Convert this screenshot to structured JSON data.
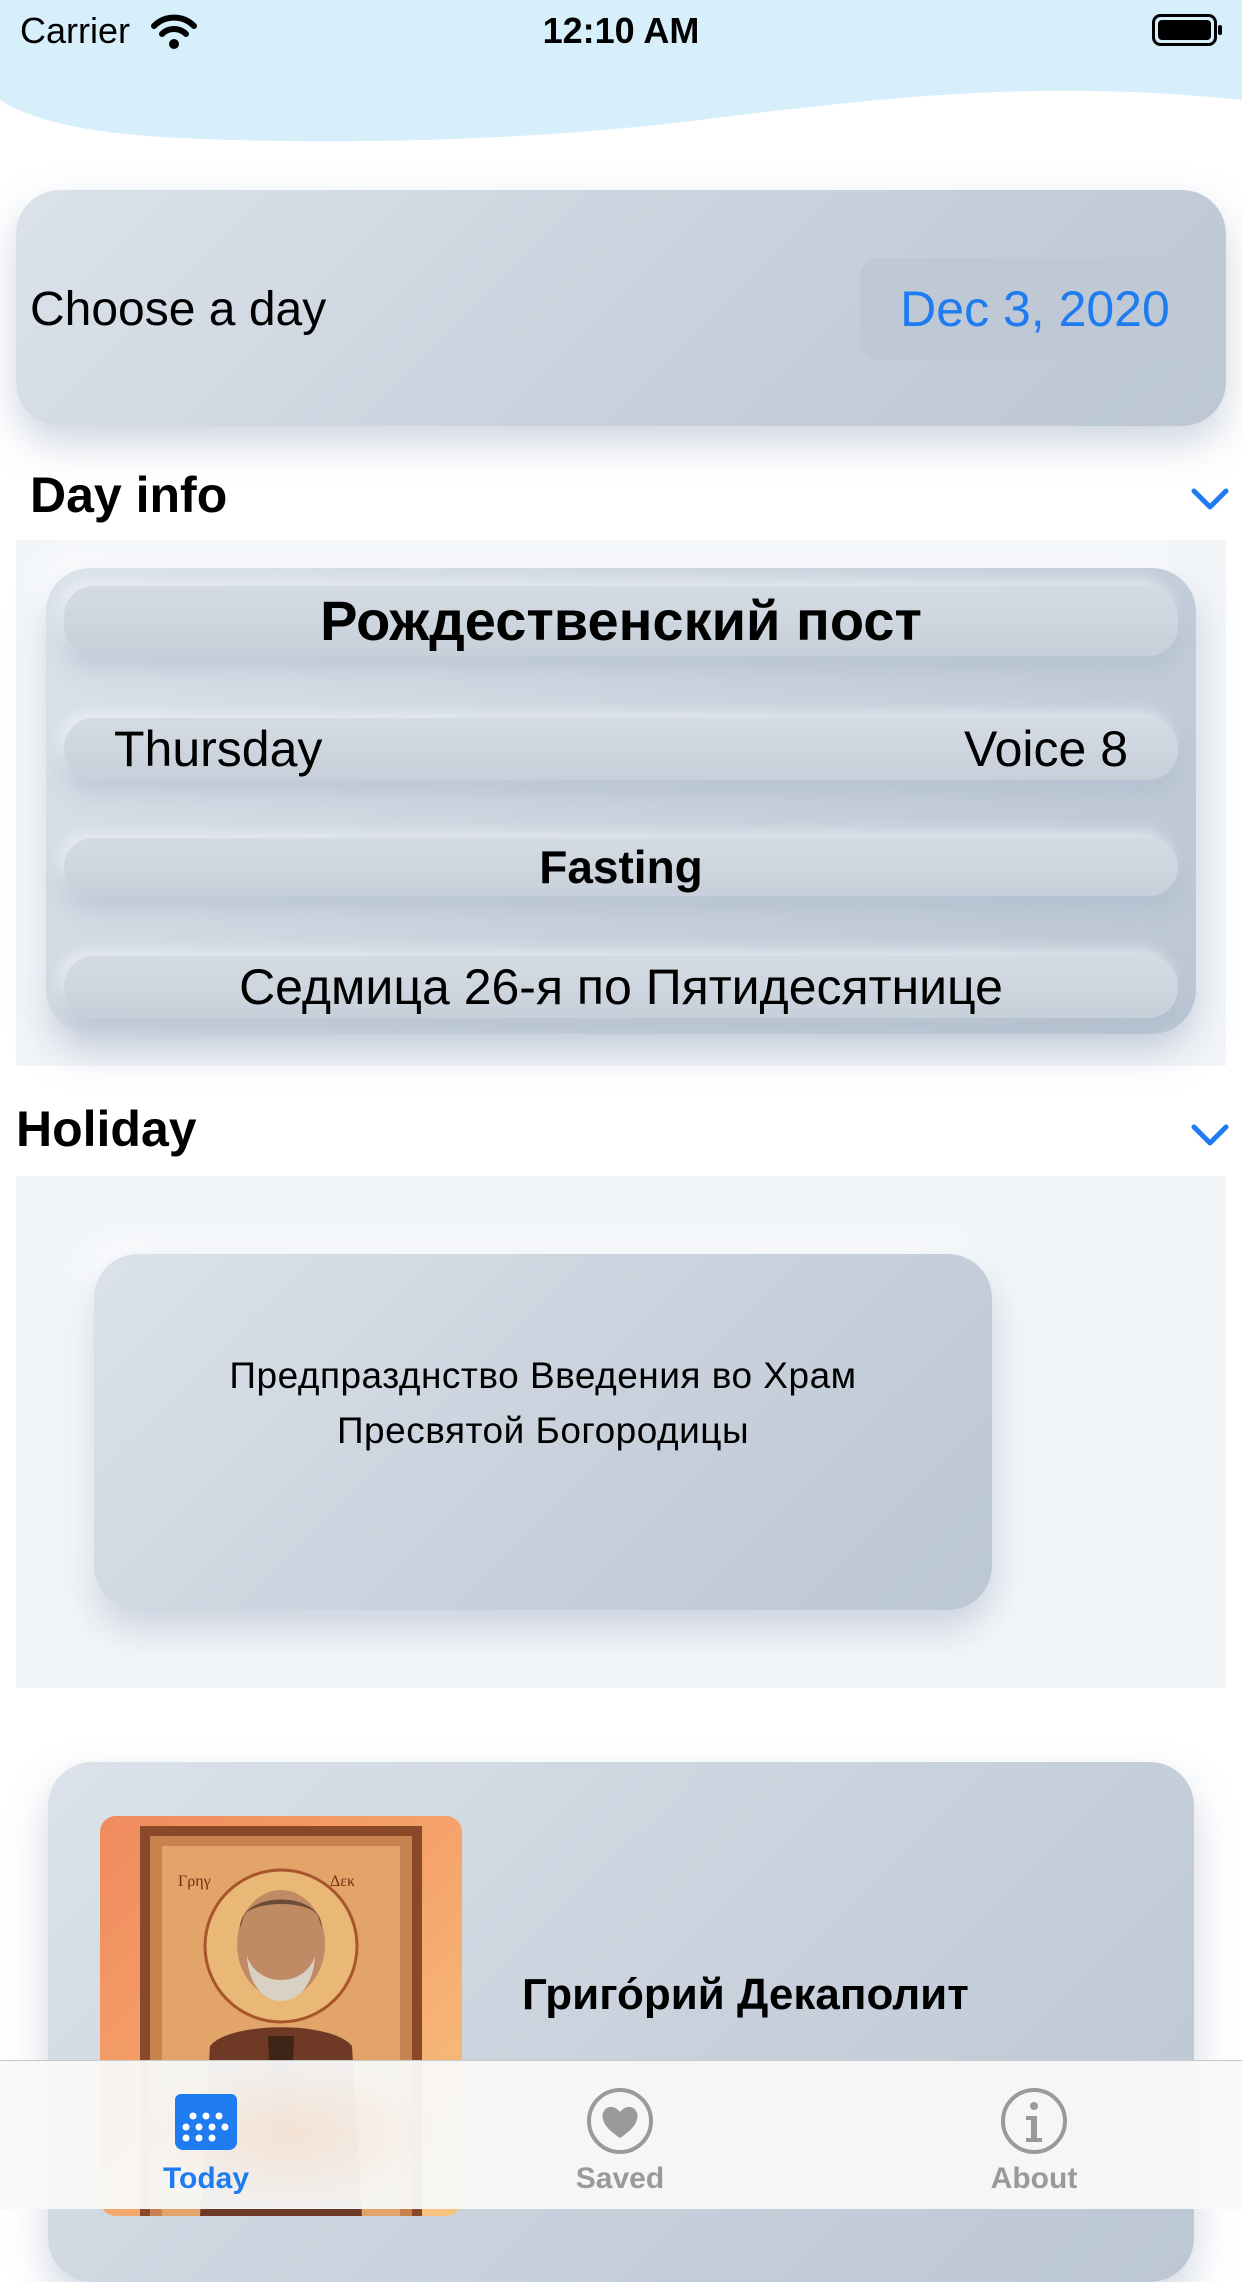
{
  "status_bar": {
    "carrier": "Carrier",
    "time": "12:10 AM"
  },
  "date_picker": {
    "label": "Choose a day",
    "value": "Dec 3, 2020"
  },
  "day_info": {
    "header": "Day info",
    "title": "Рождественский пост",
    "weekday": "Thursday",
    "voice": "Voice 8",
    "fasting": "Fasting",
    "week": "Седмица 26-я по Пятидесятнице"
  },
  "holiday": {
    "header": "Holiday",
    "line1": "Предпраздн­ство Введения во Храм",
    "line2": "Пресвятой Богородицы"
  },
  "saint": {
    "name": "Григо́рий Декаполит"
  },
  "tabs": [
    {
      "label": "Today",
      "icon": "calendar-icon",
      "active": true
    },
    {
      "label": "Saved",
      "icon": "heart-icon",
      "active": false
    },
    {
      "label": "About",
      "icon": "info-icon",
      "active": false
    }
  ],
  "colors": {
    "accent": "#1e7cf0",
    "card": "#c8d1dc",
    "wave": "#d6effa"
  }
}
